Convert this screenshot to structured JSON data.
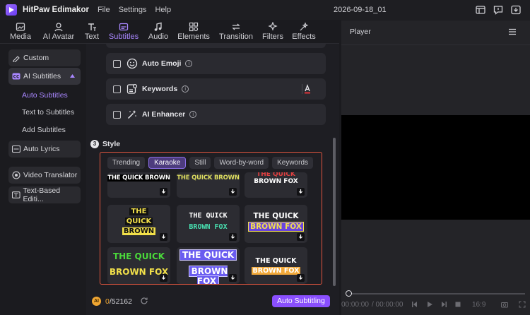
{
  "app": {
    "name": "HitPaw Edimakor",
    "menu": [
      "File",
      "Settings",
      "Help"
    ],
    "doc_title": "2026-09-18_01"
  },
  "toolbar": {
    "tabs": [
      {
        "label": "Media",
        "icon": "media-icon"
      },
      {
        "label": "AI Avatar",
        "icon": "ai-avatar-icon"
      },
      {
        "label": "Text",
        "icon": "text-icon"
      },
      {
        "label": "Subtitles",
        "icon": "subtitles-icon",
        "active": true
      },
      {
        "label": "Audio",
        "icon": "audio-icon"
      },
      {
        "label": "Elements",
        "icon": "elements-icon"
      },
      {
        "label": "Transition",
        "icon": "transition-icon"
      },
      {
        "label": "Filters",
        "icon": "filters-icon"
      },
      {
        "label": "Effects",
        "icon": "effects-icon"
      }
    ]
  },
  "sidebar": {
    "custom": "Custom",
    "ai_subtitles": "AI Subtitles",
    "sub_items": [
      "Auto Subtitles",
      "Text to Subtitles",
      "Add Subtitles"
    ],
    "auto_lyrics": "Auto Lyrics",
    "video_translator": "Video Translator",
    "text_based": "Text-Based Editi..."
  },
  "options": {
    "auto_emoji": "Auto Emoji",
    "keywords": "Keywords",
    "ai_enhancer": "AI Enhancer"
  },
  "style": {
    "step_number": "3",
    "title": "Style",
    "filters": [
      "Trending",
      "Karaoke",
      "Still",
      "Word-by-word",
      "Keywords"
    ],
    "active_filter": "Karaoke",
    "presets": [
      {
        "line1": "THE QUICK BROWN",
        "line2": ""
      },
      {
        "line1": "THE QUICK BROWN",
        "line2": ""
      },
      {
        "line1": "THE QUICK",
        "line2": "BROWN FOX"
      },
      {
        "line1": "THE",
        "line2": "QUICK",
        "line3": "BROWN"
      },
      {
        "line1": "THE QUICK",
        "line2": "BROWN FOX"
      },
      {
        "line1": "THE QUICK",
        "line2": "BROWN FOX"
      },
      {
        "line1": "THE QUICK",
        "line2": "BROWN FOX"
      },
      {
        "line1": "THE QUICK",
        "line2": "BROWN FOX"
      },
      {
        "line1": "THE QUICK",
        "line2": "BROWN FOX"
      }
    ]
  },
  "footer": {
    "credits_used": "0",
    "credits_total": "/52162",
    "auto_button": "Auto Subtitling"
  },
  "player": {
    "title": "Player",
    "time_current": "00:00:00",
    "time_total": "/ 00:00:00",
    "aspect": "16:9"
  },
  "colors": {
    "accent": "#a987ff",
    "button": "#8a4fff",
    "highlight_border": "#e2563f"
  }
}
